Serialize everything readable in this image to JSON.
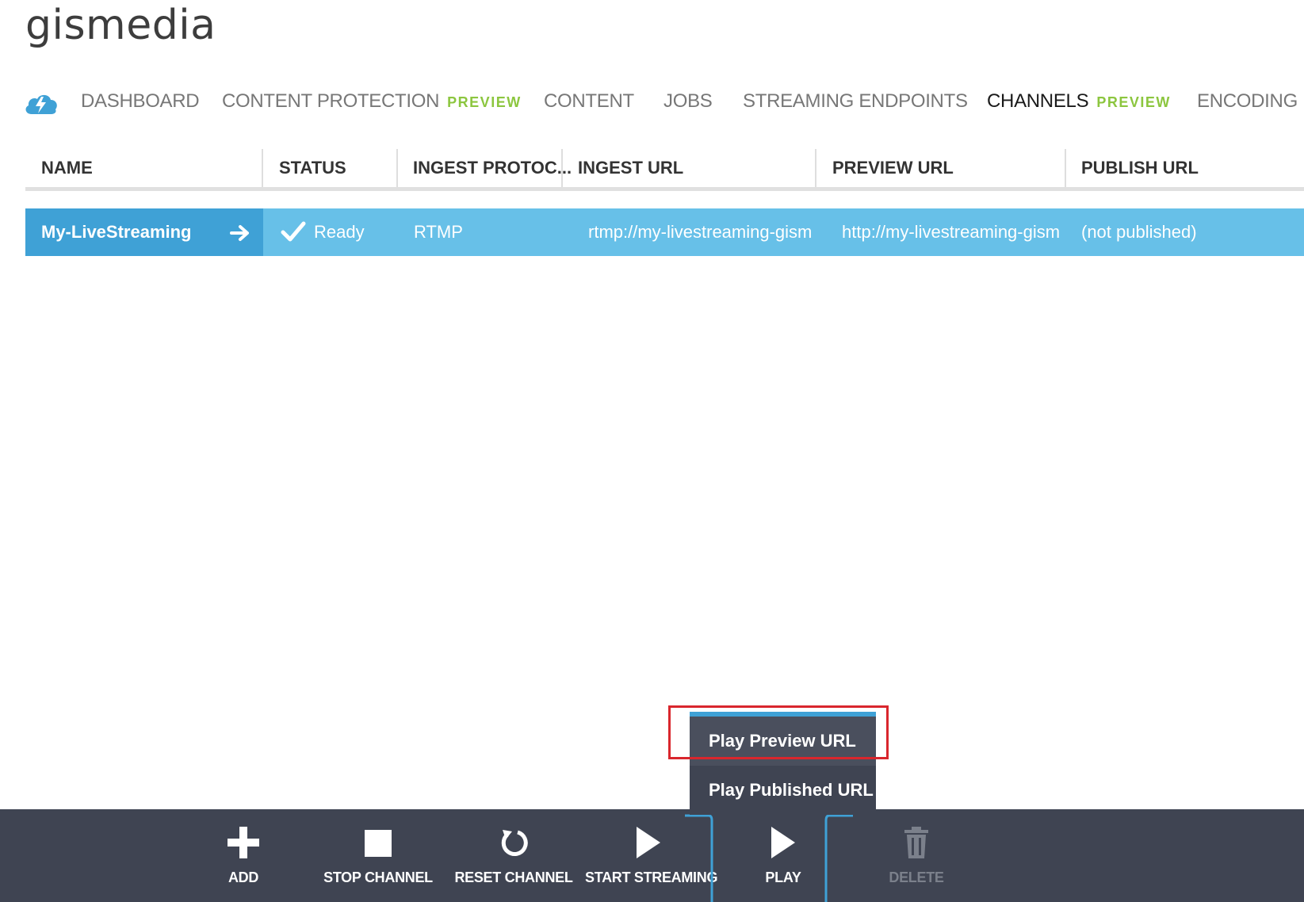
{
  "app": {
    "title": "gismedia"
  },
  "nav": {
    "items": [
      {
        "label": "DASHBOARD",
        "badge": ""
      },
      {
        "label": "CONTENT PROTECTION",
        "badge": "PREVIEW"
      },
      {
        "label": "CONTENT",
        "badge": ""
      },
      {
        "label": "JOBS",
        "badge": ""
      },
      {
        "label": "STREAMING ENDPOINTS",
        "badge": ""
      },
      {
        "label": "CHANNELS",
        "badge": "PREVIEW",
        "active": true
      },
      {
        "label": "ENCODING",
        "badge": ""
      }
    ]
  },
  "grid": {
    "columns": [
      "NAME",
      "STATUS",
      "INGEST PROTOC...",
      "INGEST URL",
      "PREVIEW URL",
      "PUBLISH URL"
    ],
    "rows": [
      {
        "name": "My-LiveStreaming",
        "status": "Ready",
        "ingest_protocol": "RTMP",
        "ingest_url": "rtmp://my-livestreaming-gism",
        "preview_url": "http://my-livestreaming-gism",
        "publish_url": "(not published)"
      }
    ]
  },
  "menu": {
    "items": [
      "Play Preview URL",
      "Play Published URL"
    ]
  },
  "toolbar": {
    "buttons": [
      {
        "label": "ADD",
        "icon": "plus-icon"
      },
      {
        "label": "STOP CHANNEL",
        "icon": "stop-icon"
      },
      {
        "label": "RESET CHANNEL",
        "icon": "reset-icon"
      },
      {
        "label": "START STREAMING",
        "icon": "play-icon"
      },
      {
        "label": "PLAY",
        "icon": "play-icon"
      },
      {
        "label": "DELETE",
        "icon": "trash-icon",
        "disabled": true
      }
    ]
  },
  "colors": {
    "accent": "#3fa1d6",
    "row_selected": "#67c0e8",
    "toolbar_bg": "#3f4452",
    "preview_badge": "#8cc63f",
    "highlight": "#d9262d"
  }
}
